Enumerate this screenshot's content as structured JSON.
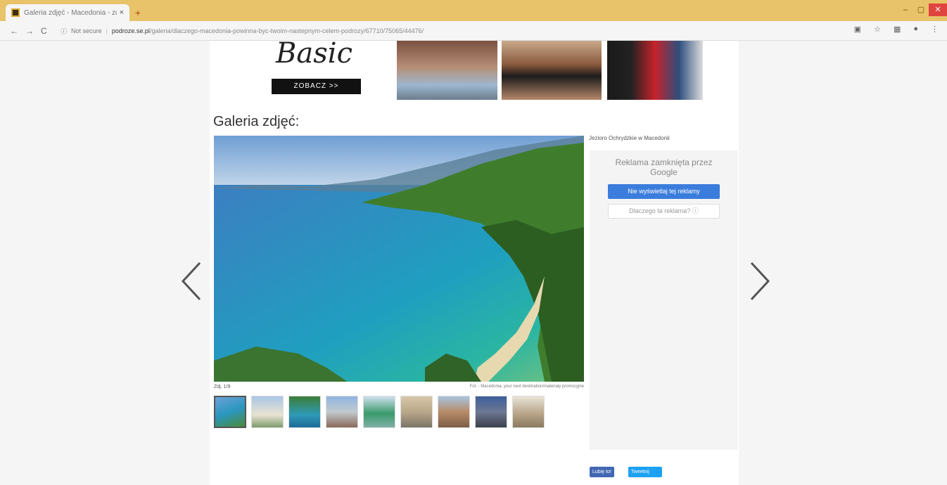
{
  "browser": {
    "tab_title": "Galeria zdjęć - Macedonia - zdj...",
    "tab_close": "×",
    "new_tab": "+",
    "window_controls": {
      "minimize": "–",
      "maximize": "▢",
      "close": "✕"
    },
    "nav": {
      "back": "←",
      "forward": "→",
      "reload": "C"
    },
    "security": "Not secure",
    "url_domain": "podroze.se.pl",
    "url_path": "/galeria/dlaczego-macedonia-powinna-byc-twoim-nastepnym-celem-podrozy/67710/75065/44476/",
    "extensions": [
      "extension-icon",
      "star-icon",
      "menu-extension-icon",
      "account-icon"
    ]
  },
  "banner": {
    "brand": "Basic",
    "cta": "ZOBACZ >>"
  },
  "gallery": {
    "heading": "Galeria zdjęć:",
    "photo_caption": "Jezioro Ochrydzkie w Macedonii",
    "photo_count_label": "Zdj. 1/9",
    "photo_credit": "Fot. - Macedonia, your next destination/materiały promocyjne",
    "thumbnails": [
      {
        "label": "lake-aerial"
      },
      {
        "label": "beach"
      },
      {
        "label": "coast"
      },
      {
        "label": "town"
      },
      {
        "label": "island"
      },
      {
        "label": "building"
      },
      {
        "label": "square"
      },
      {
        "label": "church"
      },
      {
        "label": "ruins"
      }
    ]
  },
  "ad": {
    "closed_text": "Reklama zamknięta przez",
    "provider": "Google",
    "stop_button": "Nie wyświetlaj tej reklamy",
    "why_button": "Dlaczego ta reklama? ⓘ"
  },
  "share": {
    "like": "Lubię to!",
    "tweet": "Tweetnij"
  },
  "colors": {
    "chrome_top": "#e8c36a",
    "ad_button": "#3b7ddd",
    "facebook": "#4267b2",
    "twitter": "#1da1f2"
  }
}
